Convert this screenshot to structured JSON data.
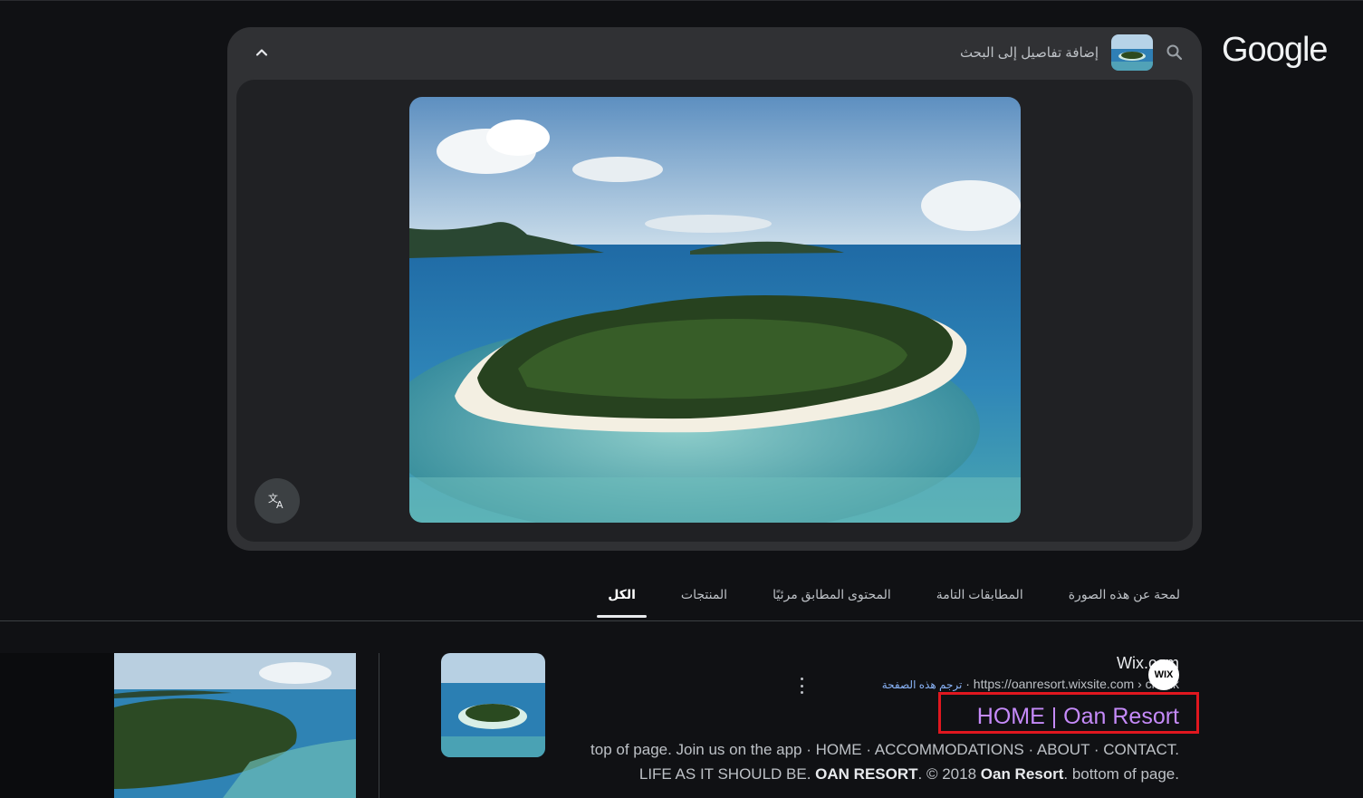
{
  "logo": {
    "text": "Google"
  },
  "lens": {
    "header_text": "إضافة تفاصيل إلى البحث"
  },
  "tabs": [
    {
      "label": "الكل",
      "active": true
    },
    {
      "label": "المنتجات",
      "active": false
    },
    {
      "label": "المحتوى المطابق مرئيًا",
      "active": false
    },
    {
      "label": "المطابقات التامة",
      "active": false
    },
    {
      "label": "لمحة عن هذه الصورة",
      "active": false
    }
  ],
  "result": {
    "site_name": "Wix.com",
    "favicon_text": "WIX",
    "url": "https://oanresort.wixsite.com › chuuk",
    "translate_link": "ترجم هذه الصفحة",
    "separator": "·",
    "title": "HOME | Oan Resort",
    "snippet_line1": "top of page. Join us on the app · HOME · ACCOMMODATIONS · ABOUT · CONTACT.",
    "snippet_line2_a": "LIFE AS IT SHOULD BE. ",
    "snippet_line2_b": "OAN RESORT",
    "snippet_line2_c": ". © 2018 ",
    "snippet_line2_d": "Oan Resort",
    "snippet_line2_e": ". bottom of page."
  },
  "colors": {
    "background": "#101114",
    "panel": "#303134",
    "title_link": "#c58af9",
    "highlight_box": "#e0171f",
    "translate_link": "#8ab4f8"
  }
}
